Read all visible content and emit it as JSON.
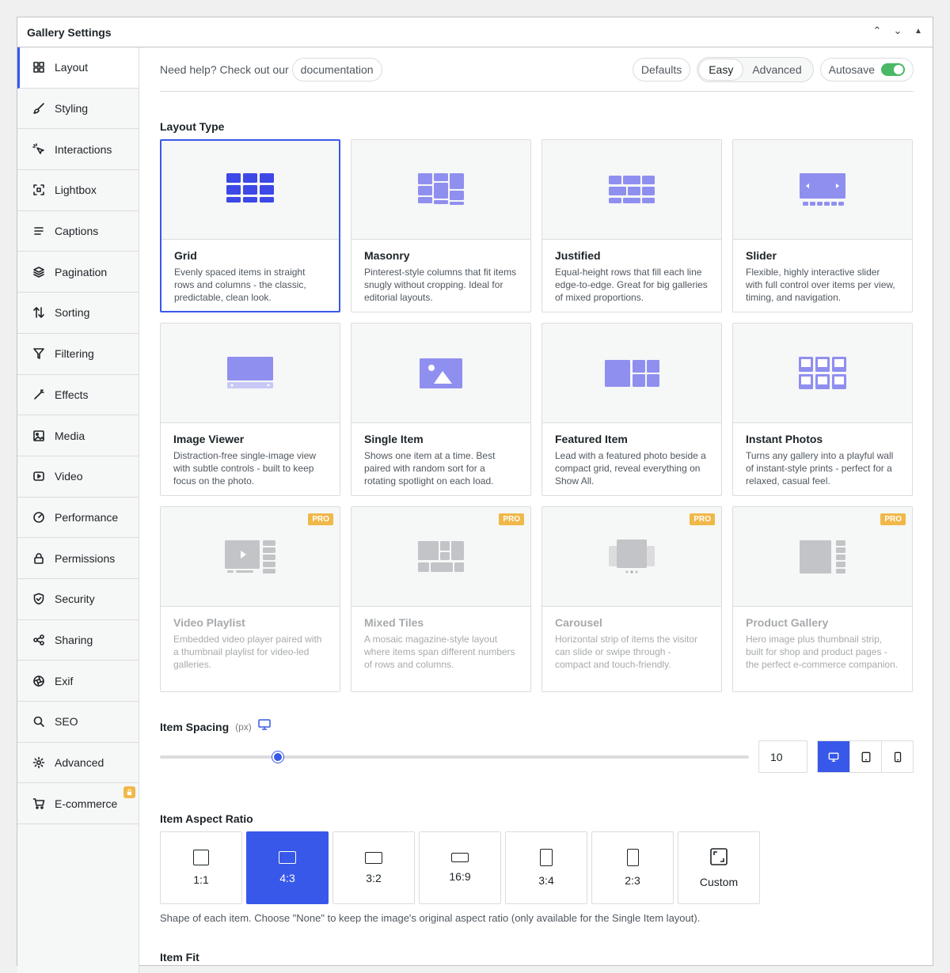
{
  "panel": {
    "title": "Gallery Settings"
  },
  "sidebar": {
    "items": [
      {
        "label": "Layout",
        "icon": "grid-icon",
        "active": true
      },
      {
        "label": "Styling",
        "icon": "brush-icon"
      },
      {
        "label": "Interactions",
        "icon": "pointer-icon"
      },
      {
        "label": "Lightbox",
        "icon": "lightbox-icon"
      },
      {
        "label": "Captions",
        "icon": "captions-icon"
      },
      {
        "label": "Pagination",
        "icon": "layers-icon"
      },
      {
        "label": "Sorting",
        "icon": "sort-icon"
      },
      {
        "label": "Filtering",
        "icon": "filter-icon"
      },
      {
        "label": "Effects",
        "icon": "wand-icon"
      },
      {
        "label": "Media",
        "icon": "image-icon"
      },
      {
        "label": "Video",
        "icon": "video-icon"
      },
      {
        "label": "Performance",
        "icon": "gauge-icon"
      },
      {
        "label": "Permissions",
        "icon": "lock-icon"
      },
      {
        "label": "Security",
        "icon": "shield-icon"
      },
      {
        "label": "Sharing",
        "icon": "share-icon"
      },
      {
        "label": "Exif",
        "icon": "aperture-icon"
      },
      {
        "label": "SEO",
        "icon": "search-icon"
      },
      {
        "label": "Advanced",
        "icon": "gear-icon"
      },
      {
        "label": "E-commerce",
        "icon": "cart-icon",
        "locked": true
      }
    ]
  },
  "topbar": {
    "help_text": "Need help? Check out our",
    "doc_link": "documentation",
    "defaults": "Defaults",
    "easy": "Easy",
    "advanced": "Advanced",
    "autosave": "Autosave",
    "autosave_on": true
  },
  "layout_type": {
    "label": "Layout Type",
    "cards": [
      {
        "name": "Grid",
        "desc": "Evenly spaced items in straight rows and columns - the classic, predictable, clean look.",
        "selected": true
      },
      {
        "name": "Masonry",
        "desc": "Pinterest-style columns that fit items snugly without cropping. Ideal for editorial layouts."
      },
      {
        "name": "Justified",
        "desc": "Equal-height rows that fill each line edge-to-edge. Great for big galleries of mixed proportions."
      },
      {
        "name": "Slider",
        "desc": "Flexible, highly interactive slider with full control over items per view, timing, and navigation."
      },
      {
        "name": "Image Viewer",
        "desc": "Distraction-free single-image view with subtle controls - built to keep focus on the photo."
      },
      {
        "name": "Single Item",
        "desc": "Shows one item at a time. Best paired with random sort for a rotating spotlight on each load."
      },
      {
        "name": "Featured Item",
        "desc": "Lead with a featured photo beside a compact grid, reveal everything on Show All."
      },
      {
        "name": "Instant Photos",
        "desc": "Turns any gallery into a playful wall of instant-style prints - perfect for a relaxed, casual feel."
      },
      {
        "name": "Video Playlist",
        "desc": "Embedded video player paired with a thumbnail playlist for video-led galleries.",
        "pro": true
      },
      {
        "name": "Mixed Tiles",
        "desc": "A mosaic magazine-style layout where items span different numbers of rows and columns.",
        "pro": true
      },
      {
        "name": "Carousel",
        "desc": "Horizontal strip of items the visitor can slide or swipe through - compact and touch-friendly.",
        "pro": true
      },
      {
        "name": "Product Gallery",
        "desc": "Hero image plus thumbnail strip, built for shop and product pages - the perfect e-commerce companion.",
        "pro": true
      }
    ],
    "pro_badge": "PRO"
  },
  "item_spacing": {
    "label": "Item Spacing",
    "unit": "(px)",
    "value": "10",
    "min": 0,
    "max": 50,
    "current": 10
  },
  "aspect_ratio": {
    "label": "Item Aspect Ratio",
    "options": [
      "1:1",
      "4:3",
      "3:2",
      "16:9",
      "3:4",
      "2:3",
      "Custom"
    ],
    "selected": "4:3",
    "hint": "Shape of each item. Choose \"None\" to keep the image's original aspect ratio (only available for the Single Item layout)."
  },
  "item_fit": {
    "label": "Item Fit"
  },
  "colors": {
    "accent": "#3858e9",
    "thumb": "#8f8ff0",
    "pro_badge": "#f0b849",
    "toggle": "#4ab866"
  }
}
